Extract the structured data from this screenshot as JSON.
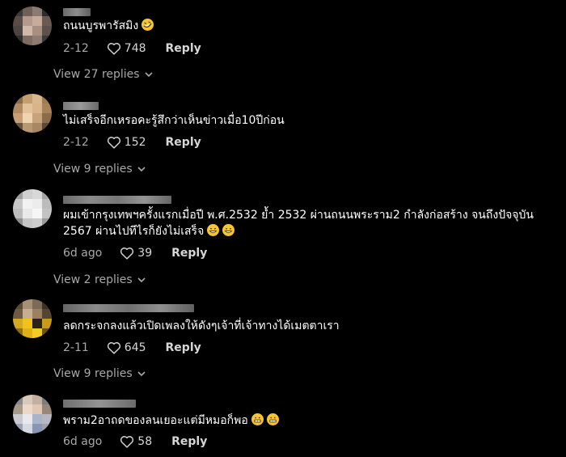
{
  "comments": [
    {
      "text": "ถนนบูรพารัสมิง",
      "emoji": "rofl-emoji",
      "date": "2-12",
      "likes": "748",
      "reply_label": "Reply",
      "view_replies": "View 27 replies"
    },
    {
      "text": "ไม่เสร็จอีกเหรอคะรู้สึกว่าเห็นข่าวเมื่อ10ปีก่อน",
      "date": "2-12",
      "likes": "152",
      "reply_label": "Reply",
      "view_replies": "View 9 replies"
    },
    {
      "text_line1": "ผมเข้ากรุงเทพฯครั้งแรกเมื่อปี พ.ศ.2532 ย้ำ 2532 ผ่านถนนพระราม2 กำลังก่อสร้าง จนถึงปัจจุบัน",
      "text_line2": "2567 ผ่านไปทีไรก็ยังไม่เสร็จ",
      "emoji": "grinning-sweat-emoji",
      "date": "6d ago",
      "likes": "39",
      "reply_label": "Reply",
      "view_replies": "View 2 replies"
    },
    {
      "text": "ลดกระจกลงแล้วเปิดเพลงให้ดังๆเจ้าที่เจ้าทางได้เมตตาเรา",
      "date": "2-11",
      "likes": "645",
      "reply_label": "Reply",
      "view_replies": "View 9 replies"
    },
    {
      "text": "พราม2อาถดของลนเยอะแต่มีหมอก็พอ",
      "emoji": "grimacing-emoji",
      "date": "6d ago",
      "likes": "58",
      "reply_label": "Reply"
    }
  ],
  "icons": {
    "like": "heart-outline-icon",
    "expand": "chevron-down-icon"
  },
  "colors": {
    "background": "#000000",
    "text": "#ffffff",
    "muted": "#a8a8a8",
    "accent_emoji": "#f7c531"
  }
}
